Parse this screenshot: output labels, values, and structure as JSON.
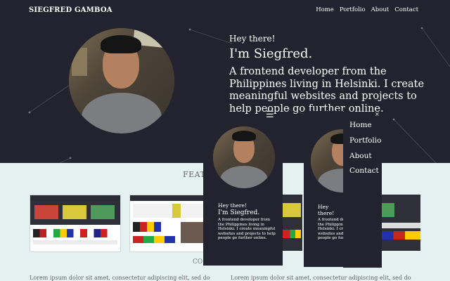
{
  "nav": {
    "brand": "SIEGFRED GAMBOA",
    "links": [
      "Home",
      "Portfolio",
      "About",
      "Contact"
    ]
  },
  "hero": {
    "greeting": "Hey there!",
    "name": "I'm Siegfred.",
    "description": "A frontend developer from the Philippines living in Helsinki. I create meaningful websites and projects to help people go further online."
  },
  "featured": {
    "title": "FEAT"
  },
  "content": {
    "heading_partial": "CO",
    "lorem_left": "Lorem ipsum dolor sit amet, consectetur adipiscing elit, sed do",
    "lorem_right": "Lorem ipsum dolor sit amet, consectetur adipiscing elit, sed do"
  },
  "mobile_preview": {
    "greeting": "Hey there!",
    "name": "I'm Siegfred.",
    "description": "A frontend developer from the Philippines living in Helsinki. I create meaningful websites and projects to help people go further online."
  },
  "mobile_menu": {
    "items": [
      "Home",
      "Portfolio",
      "About",
      "Contact"
    ],
    "open_icon": "☰",
    "close_icon": "×"
  },
  "colors": {
    "hero_bg": "#23232f",
    "page_bg": "#e3f1f0",
    "card_red": "#c8453b",
    "card_yellow": "#d8c83c",
    "card_green": "#4e9a58"
  }
}
